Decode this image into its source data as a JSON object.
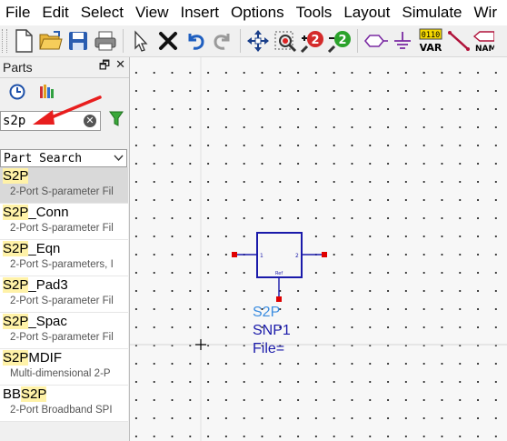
{
  "menu": [
    "File",
    "Edit",
    "Select",
    "View",
    "Insert",
    "Options",
    "Tools",
    "Layout",
    "Simulate",
    "Wir"
  ],
  "toolbar": {
    "icons": [
      "new-file-icon",
      "open-folder-icon",
      "save-icon",
      "print-icon",
      "select-arrow-icon",
      "delete-x-icon",
      "undo-icon",
      "redo-icon",
      "move-icon",
      "zoom-area-icon",
      "zoom-in-icon",
      "zoom-out-icon",
      "port-icon",
      "ground-icon",
      "var-icon",
      "wire-icon",
      "name-icon"
    ],
    "var_label": "VAR",
    "var_number": "0110",
    "name_label": "NAM"
  },
  "parts": {
    "title": "Parts",
    "float_glyph": "🗗",
    "close_glyph": "✕",
    "search_value": "s2p",
    "clear_glyph": "✕",
    "dropdown_label": "Part Search",
    "results": [
      {
        "pre": "",
        "hl": "S2P",
        "post": "",
        "desc": "2-Port S-parameter Fil",
        "selected": true
      },
      {
        "pre": "",
        "hl": "S2P",
        "post": "_Conn",
        "desc": "2-Port S-parameter Fil",
        "selected": false
      },
      {
        "pre": "",
        "hl": "S2P",
        "post": "_Eqn",
        "desc": "2-Port S-parameters, I",
        "selected": false
      },
      {
        "pre": "",
        "hl": "S2P",
        "post": "_Pad3",
        "desc": "2-Port S-parameter Fil",
        "selected": false
      },
      {
        "pre": "",
        "hl": "S2P",
        "post": "_Spac",
        "desc": "2-Port S-parameter Fil",
        "selected": false
      },
      {
        "pre": "",
        "hl": "S2P",
        "post": "MDIF",
        "desc": "Multi-dimensional 2-P",
        "selected": false
      },
      {
        "pre": "BB",
        "hl": "S2P",
        "post": "",
        "desc": "2-Port Broadband SPI",
        "selected": false
      }
    ]
  },
  "component": {
    "type_label": "S2P",
    "instance": "SNP1",
    "file_param": "File=",
    "pin1": "1",
    "pin2": "2",
    "ref_text": "Ref"
  },
  "colors": {
    "component_blue": "#1a1aaa",
    "type_label": "#3c8de0",
    "pin_red": "#e00000",
    "highlight": "#fff2a8"
  }
}
